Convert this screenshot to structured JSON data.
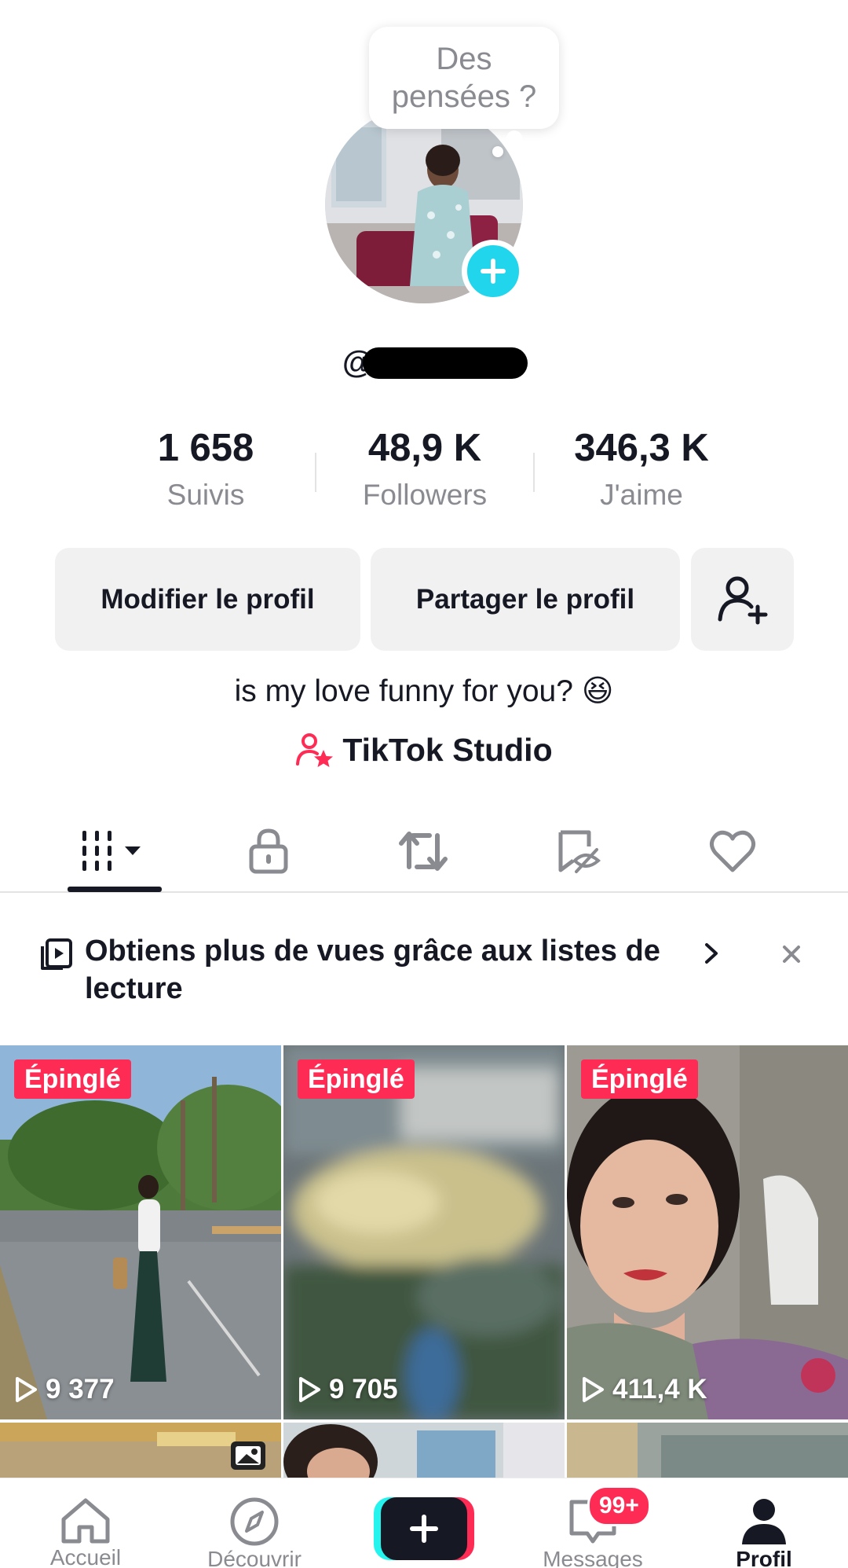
{
  "profile": {
    "thought_bubble": "Des\npensées ?",
    "username_prefix": "@"
  },
  "stats": [
    {
      "value": "1 658",
      "label": "Suivis"
    },
    {
      "value": "48,9 K",
      "label": "Followers"
    },
    {
      "value": "346,3 K",
      "label": "J'aime"
    }
  ],
  "buttons": {
    "edit": "Modifier le profil",
    "share": "Partager le profil"
  },
  "bio": "is my love funny for you? 😆",
  "studio_link": "TikTok Studio",
  "banner": {
    "text": "Obtiens plus de vues grâce aux listes de lecture"
  },
  "videos": [
    {
      "pinned_label": "Épinglé",
      "views": "9 377"
    },
    {
      "pinned_label": "Épinglé",
      "views": "9 705"
    },
    {
      "pinned_label": "Épinglé",
      "views": "411,4 K"
    }
  ],
  "nav": {
    "home": "Accueil",
    "discover": "Découvrir",
    "messages": "Messages",
    "messages_badge": "99+",
    "profile": "Profil"
  },
  "colors": {
    "accent": "#fe2c55",
    "avatar_plus": "#20d5ec",
    "text": "#161823",
    "muted": "#8a8b91"
  }
}
